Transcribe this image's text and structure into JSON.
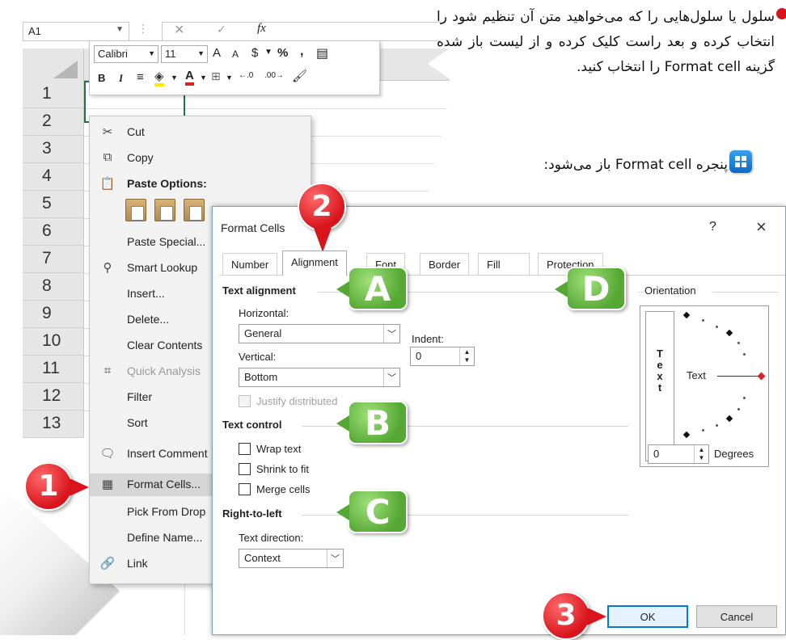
{
  "excel": {
    "namebox": "A1",
    "fx": "fx",
    "rows": [
      "1",
      "2",
      "3",
      "4",
      "5",
      "6",
      "7",
      "8",
      "9",
      "10",
      "11",
      "12",
      "13"
    ]
  },
  "minitoolbar": {
    "font": "Calibri",
    "size": "11",
    "bold": "B",
    "italic": "I",
    "increase_font": "A",
    "decrease_font": "A",
    "currency": "$",
    "percent": "%",
    "comma": ","
  },
  "context_menu": {
    "cut": "Cut",
    "copy": "Copy",
    "paste_options": "Paste Options:",
    "paste_special": "Paste Special...",
    "smart_lookup": "Smart Lookup",
    "insert": "Insert...",
    "delete": "Delete...",
    "clear_contents": "Clear Contents",
    "quick_analysis": "Quick Analysis",
    "filter": "Filter",
    "sort": "Sort",
    "insert_comment": "Insert Comment",
    "format_cells": "Format Cells...",
    "pick_from_dropdown": "Pick From Drop",
    "define_name": "Define Name...",
    "link": "Link"
  },
  "dialog": {
    "title": "Format Cells",
    "help": "?",
    "close": "×",
    "tabs": [
      "Number",
      "Alignment",
      "Font",
      "Border",
      "Fill",
      "Protection"
    ],
    "text_alignment": "Text alignment",
    "horizontal_label": "Horizontal:",
    "horizontal_value": "General",
    "indent_label": "Indent:",
    "indent_value": "0",
    "vertical_label": "Vertical:",
    "vertical_value": "Bottom",
    "justify_distributed": "Justify distributed",
    "text_control": "Text control",
    "wrap_text": "Wrap text",
    "shrink_to_fit": "Shrink to fit",
    "merge_cells": "Merge cells",
    "right_to_left": "Right-to-left",
    "text_direction_label": "Text direction:",
    "text_direction_value": "Context",
    "orientation": "Orientation",
    "orientation_text": "Text",
    "vertical_text": [
      "T",
      "e",
      "x",
      "t"
    ],
    "degrees_value": "0",
    "degrees_label": "Degrees",
    "ok": "OK",
    "cancel": "Cancel"
  },
  "callouts": {
    "num1": "1",
    "num2": "2",
    "num3": "3",
    "A": "A",
    "B": "B",
    "C": "C",
    "D": "D"
  },
  "instructions": {
    "line1": "سلول یا سلول‌هایی را که می‌خواهید متن آن تنظیم شود را انتخاب کرده و بعد راست کلیک کرده و از لیست باز شده گزینه Format cell را انتخاب کنید.",
    "line2": "پنجره Format cell باز می‌شود:"
  },
  "colors": {
    "excel_green": "#217346",
    "callout_red": "#d8141c",
    "callout_green": "#55a834",
    "ok_border": "#0078d7"
  }
}
